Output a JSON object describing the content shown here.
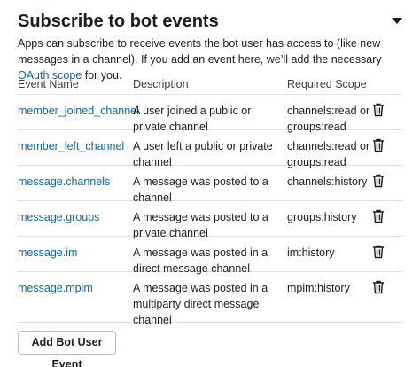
{
  "section": {
    "title": "Subscribe to bot events",
    "intro_text": "Apps can subscribe to receive events the bot user has access to (like new messages in a channel). If you add an event here, we’ll add the necessary ",
    "intro_link": "OAuth scope",
    "intro_tail": " for you."
  },
  "table": {
    "headers": {
      "event_name": "Event Name",
      "description": "Description",
      "scope": "Required Scope"
    },
    "rows": [
      {
        "event": "member_joined_channel",
        "description": "A user joined a public or private channel",
        "scope": "channels:read or groups:read"
      },
      {
        "event": "member_left_channel",
        "description": "A user left a public or private channel",
        "scope": "channels:read or groups:read"
      },
      {
        "event": "message.channels",
        "description": "A message was posted to a channel",
        "scope": "channels:history"
      },
      {
        "event": "message.groups",
        "description": "A message was posted to a private channel",
        "scope": "groups:history"
      },
      {
        "event": "message.im",
        "description": "A message was posted in a direct message channel",
        "scope": "im:history"
      },
      {
        "event": "message.mpim",
        "description": "A message was posted in a multiparty direct message channel",
        "scope": "mpim:history"
      }
    ]
  },
  "actions": {
    "add_button": "Add Bot User Event"
  },
  "icons": {
    "delete": "trash-icon",
    "collapse": "caret-down-icon"
  },
  "colors": {
    "link": "#1264a3",
    "text": "#1d1c1d",
    "divider": "#dddddd"
  }
}
